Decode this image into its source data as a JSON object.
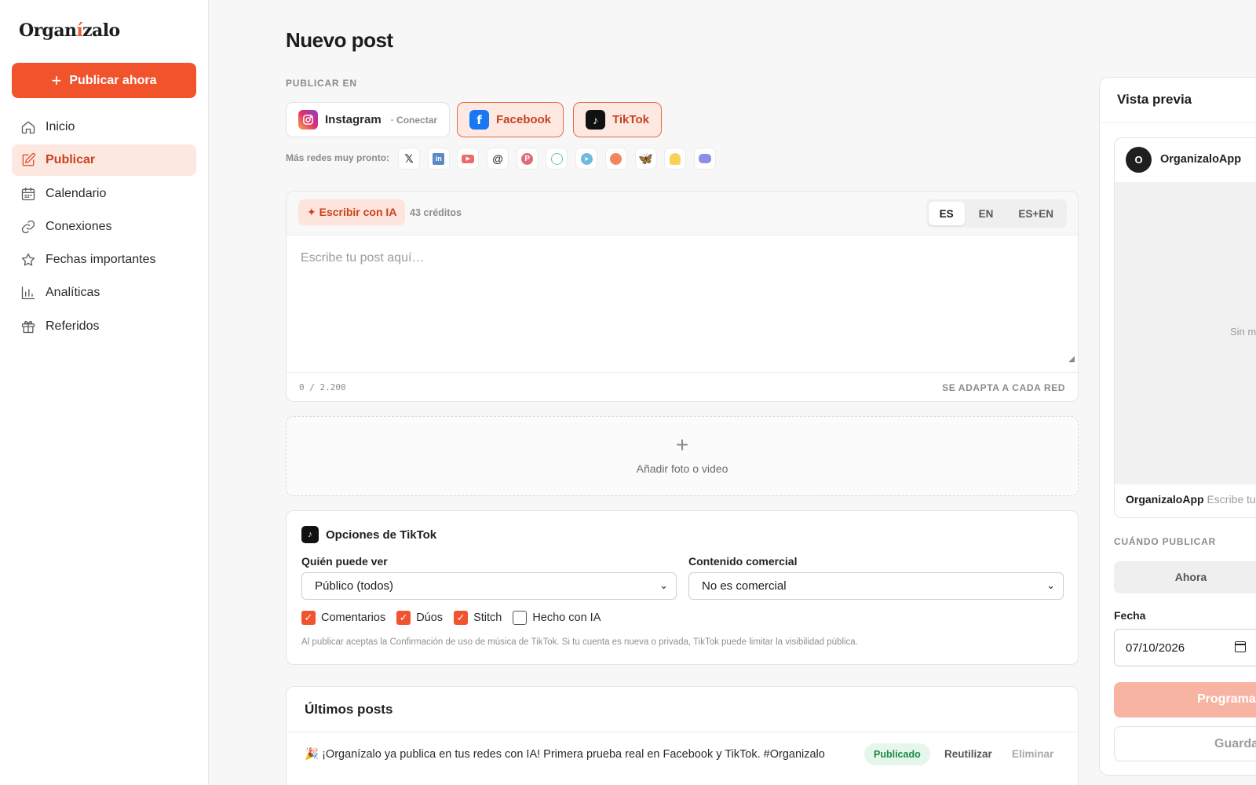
{
  "brand": {
    "logo_pre": "Organ",
    "logo_accent": "í",
    "logo_post": "zalo",
    "accent_color": "#f1532d"
  },
  "sidebar": {
    "publish_now": "Publicar ahora",
    "items": [
      {
        "label": "Inicio",
        "icon": "home-icon"
      },
      {
        "label": "Publicar",
        "icon": "edit-icon",
        "active": true
      },
      {
        "label": "Calendario",
        "icon": "calendar-icon"
      },
      {
        "label": "Conexiones",
        "icon": "link-icon"
      },
      {
        "label": "Fechas importantes",
        "icon": "star-icon"
      },
      {
        "label": "Analíticas",
        "icon": "bar-chart-icon"
      },
      {
        "label": "Referidos",
        "icon": "gift-icon"
      }
    ]
  },
  "main": {
    "title": "Nuevo post",
    "publish_in_label": "PUBLICAR EN",
    "networks": [
      {
        "name": "Instagram",
        "note": "· Conectar",
        "selected": false
      },
      {
        "name": "Facebook",
        "selected": true
      },
      {
        "name": "TikTok",
        "selected": true
      }
    ],
    "more_soon_label": "Más redes muy pronto:",
    "coming_soon_icons": [
      "x-icon",
      "linkedin-icon",
      "youtube-icon",
      "threads-icon",
      "pinterest-icon",
      "whatsapp-icon",
      "telegram-icon",
      "reddit-icon",
      "bluesky-icon",
      "snapchat-icon",
      "discord-icon"
    ],
    "editor": {
      "ai_button": "✦ Escribir con IA",
      "credits": "43 créditos",
      "languages": [
        "ES",
        "EN",
        "ES+EN"
      ],
      "selected_language": "ES",
      "placeholder": "Escribe tu post aquí…",
      "counter": "0 / 2.200",
      "adapt_note": "SE ADAPTA A CADA RED"
    },
    "media": {
      "plus": "+",
      "label": "Añadir foto o video"
    },
    "tiktok_options": {
      "title": "Opciones de TikTok",
      "who_can_view_label": "Quién puede ver",
      "who_can_view_value": "Público (todos)",
      "commercial_label": "Contenido comercial",
      "commercial_value": "No es comercial",
      "checkboxes": [
        {
          "label": "Comentarios",
          "checked": true
        },
        {
          "label": "Dúos",
          "checked": true
        },
        {
          "label": "Stitch",
          "checked": true
        },
        {
          "label": "Hecho con IA",
          "checked": false
        }
      ],
      "note": "Al publicar aceptas la Confirmación de uso de música de TikTok. Si tu cuenta es nueva o privada, TikTok puede limitar la visibilidad pública."
    },
    "latest_posts": {
      "title": "Últimos posts",
      "rows": [
        {
          "text": "🎉 ¡Organízalo ya publica en tus redes con IA! Primera prueba real en Facebook y TikTok. #Organizalo",
          "status": "Publicado",
          "reuse": "Reutilizar",
          "delete": "Eliminar"
        }
      ]
    }
  },
  "preview": {
    "title": "Vista previa",
    "avatar_letter": "O",
    "account": "OrganizaloApp",
    "media_text": "Sin m",
    "caption_account": "OrganizaloApp",
    "caption_text": "Escribe tu",
    "when_label": "CUÁNDO PUBLICAR",
    "now_option": "Ahora",
    "date_label": "Fecha",
    "date_value": "07/10/2026",
    "schedule_button": "Programa",
    "save_button": "Guarda"
  }
}
